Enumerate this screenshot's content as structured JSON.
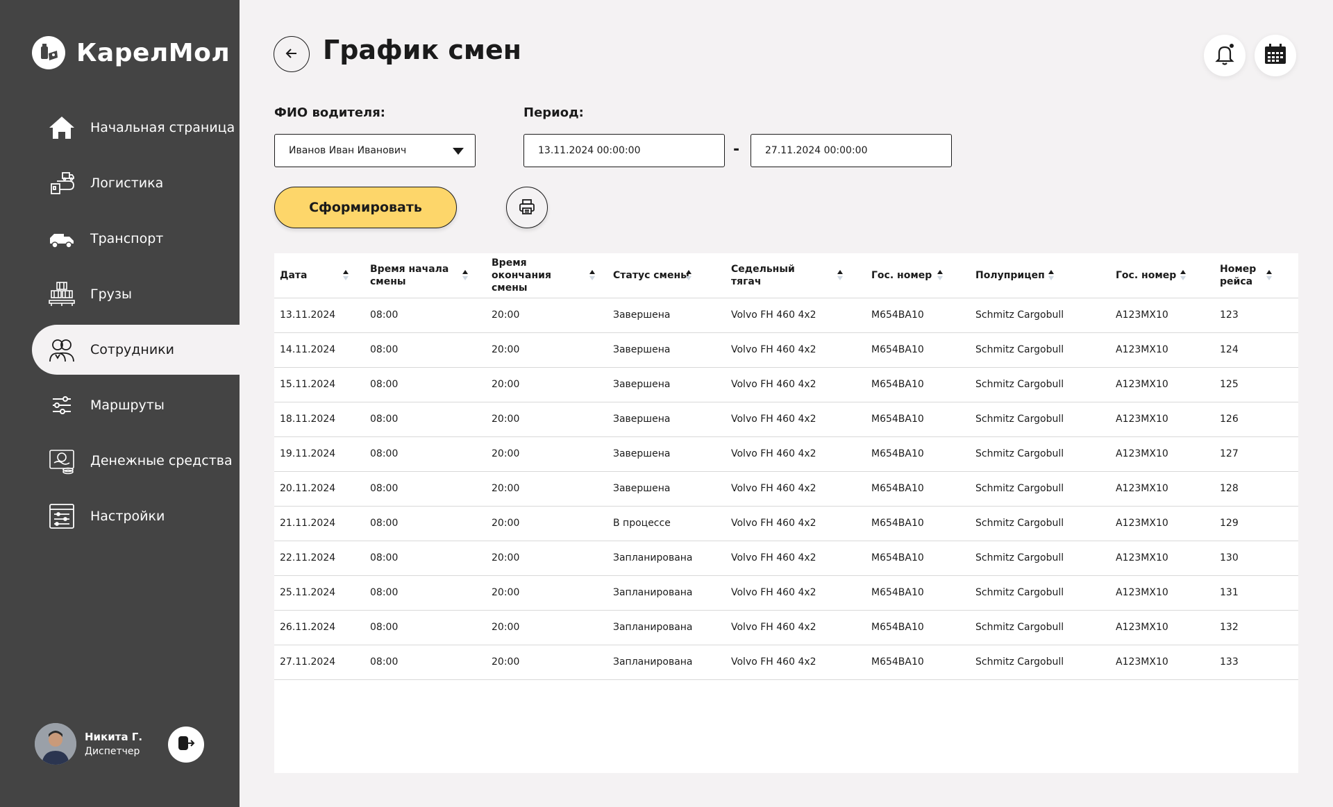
{
  "app": {
    "name": "КарелМол"
  },
  "sidebar": {
    "items": [
      {
        "label": "Начальная страница",
        "icon": "home-icon"
      },
      {
        "label": "Логистика",
        "icon": "logistics-icon"
      },
      {
        "label": "Транспорт",
        "icon": "truck-icon"
      },
      {
        "label": "Грузы",
        "icon": "cargo-icon"
      },
      {
        "label": "Сотрудники",
        "icon": "employees-icon",
        "active": true
      },
      {
        "label": "Маршруты",
        "icon": "routes-icon"
      },
      {
        "label": "Денежные средства",
        "icon": "money-icon"
      },
      {
        "label": "Настройки",
        "icon": "settings-icon"
      }
    ],
    "user": {
      "name": "Никита Г.",
      "role": "Диспетчер"
    }
  },
  "header": {
    "title": "График смен"
  },
  "filters": {
    "driver_label": "ФИО водителя:",
    "driver_value": "Иванов Иван Иванович",
    "period_label": "Период:",
    "date_from": "13.11.2024 00:00:00",
    "date_to": "27.11.2024 00:00:00",
    "dash": "-",
    "generate_label": "Сформировать"
  },
  "table": {
    "columns": [
      "Дата",
      "Время начала смены",
      "Время окончания смены",
      "Статус смены",
      "Седельный тягач",
      "Гос. номер",
      "Полуприцеп",
      "Гос. номер",
      "Номер рейса"
    ],
    "rows": [
      [
        "13.11.2024",
        "08:00",
        "20:00",
        "Завершена",
        "Volvo FH 460 4x2",
        "М654ВА10",
        "Schmitz Cargobull",
        "А123МХ10",
        "123"
      ],
      [
        "14.11.2024",
        "08:00",
        "20:00",
        "Завершена",
        "Volvo FH 460 4x2",
        "М654ВА10",
        "Schmitz Cargobull",
        "А123МХ10",
        "124"
      ],
      [
        "15.11.2024",
        "08:00",
        "20:00",
        "Завершена",
        "Volvo FH 460 4x2",
        "М654ВА10",
        "Schmitz Cargobull",
        "А123МХ10",
        "125"
      ],
      [
        "18.11.2024",
        "08:00",
        "20:00",
        "Завершена",
        "Volvo FH 460 4x2",
        "М654ВА10",
        "Schmitz Cargobull",
        "А123МХ10",
        "126"
      ],
      [
        "19.11.2024",
        "08:00",
        "20:00",
        "Завершена",
        "Volvo FH 460 4x2",
        "М654ВА10",
        "Schmitz Cargobull",
        "А123МХ10",
        "127"
      ],
      [
        "20.11.2024",
        "08:00",
        "20:00",
        "Завершена",
        "Volvo FH 460 4x2",
        "М654ВА10",
        "Schmitz Cargobull",
        "А123МХ10",
        "128"
      ],
      [
        "21.11.2024",
        "08:00",
        "20:00",
        "В процессе",
        "Volvo FH 460 4x2",
        "М654ВА10",
        "Schmitz Cargobull",
        "А123МХ10",
        "129"
      ],
      [
        "22.11.2024",
        "08:00",
        "20:00",
        "Запланирована",
        "Volvo FH 460 4x2",
        "М654ВА10",
        "Schmitz Cargobull",
        "А123МХ10",
        "130"
      ],
      [
        "25.11.2024",
        "08:00",
        "20:00",
        "Запланирована",
        "Volvo FH 460 4x2",
        "М654ВА10",
        "Schmitz Cargobull",
        "А123МХ10",
        "131"
      ],
      [
        "26.11.2024",
        "08:00",
        "20:00",
        "Запланирована",
        "Volvo FH 460 4x2",
        "М654ВА10",
        "Schmitz Cargobull",
        "А123МХ10",
        "132"
      ],
      [
        "27.11.2024",
        "08:00",
        "20:00",
        "Запланирована",
        "Volvo FH 460 4x2",
        "М654ВА10",
        "Schmitz Cargobull",
        "А123МХ10",
        "133"
      ]
    ]
  },
  "colors": {
    "sidebar_bg": "#444444",
    "page_bg": "#f4f2f3",
    "accent_yellow": "#fdd66a",
    "text": "#1b1b1b"
  }
}
